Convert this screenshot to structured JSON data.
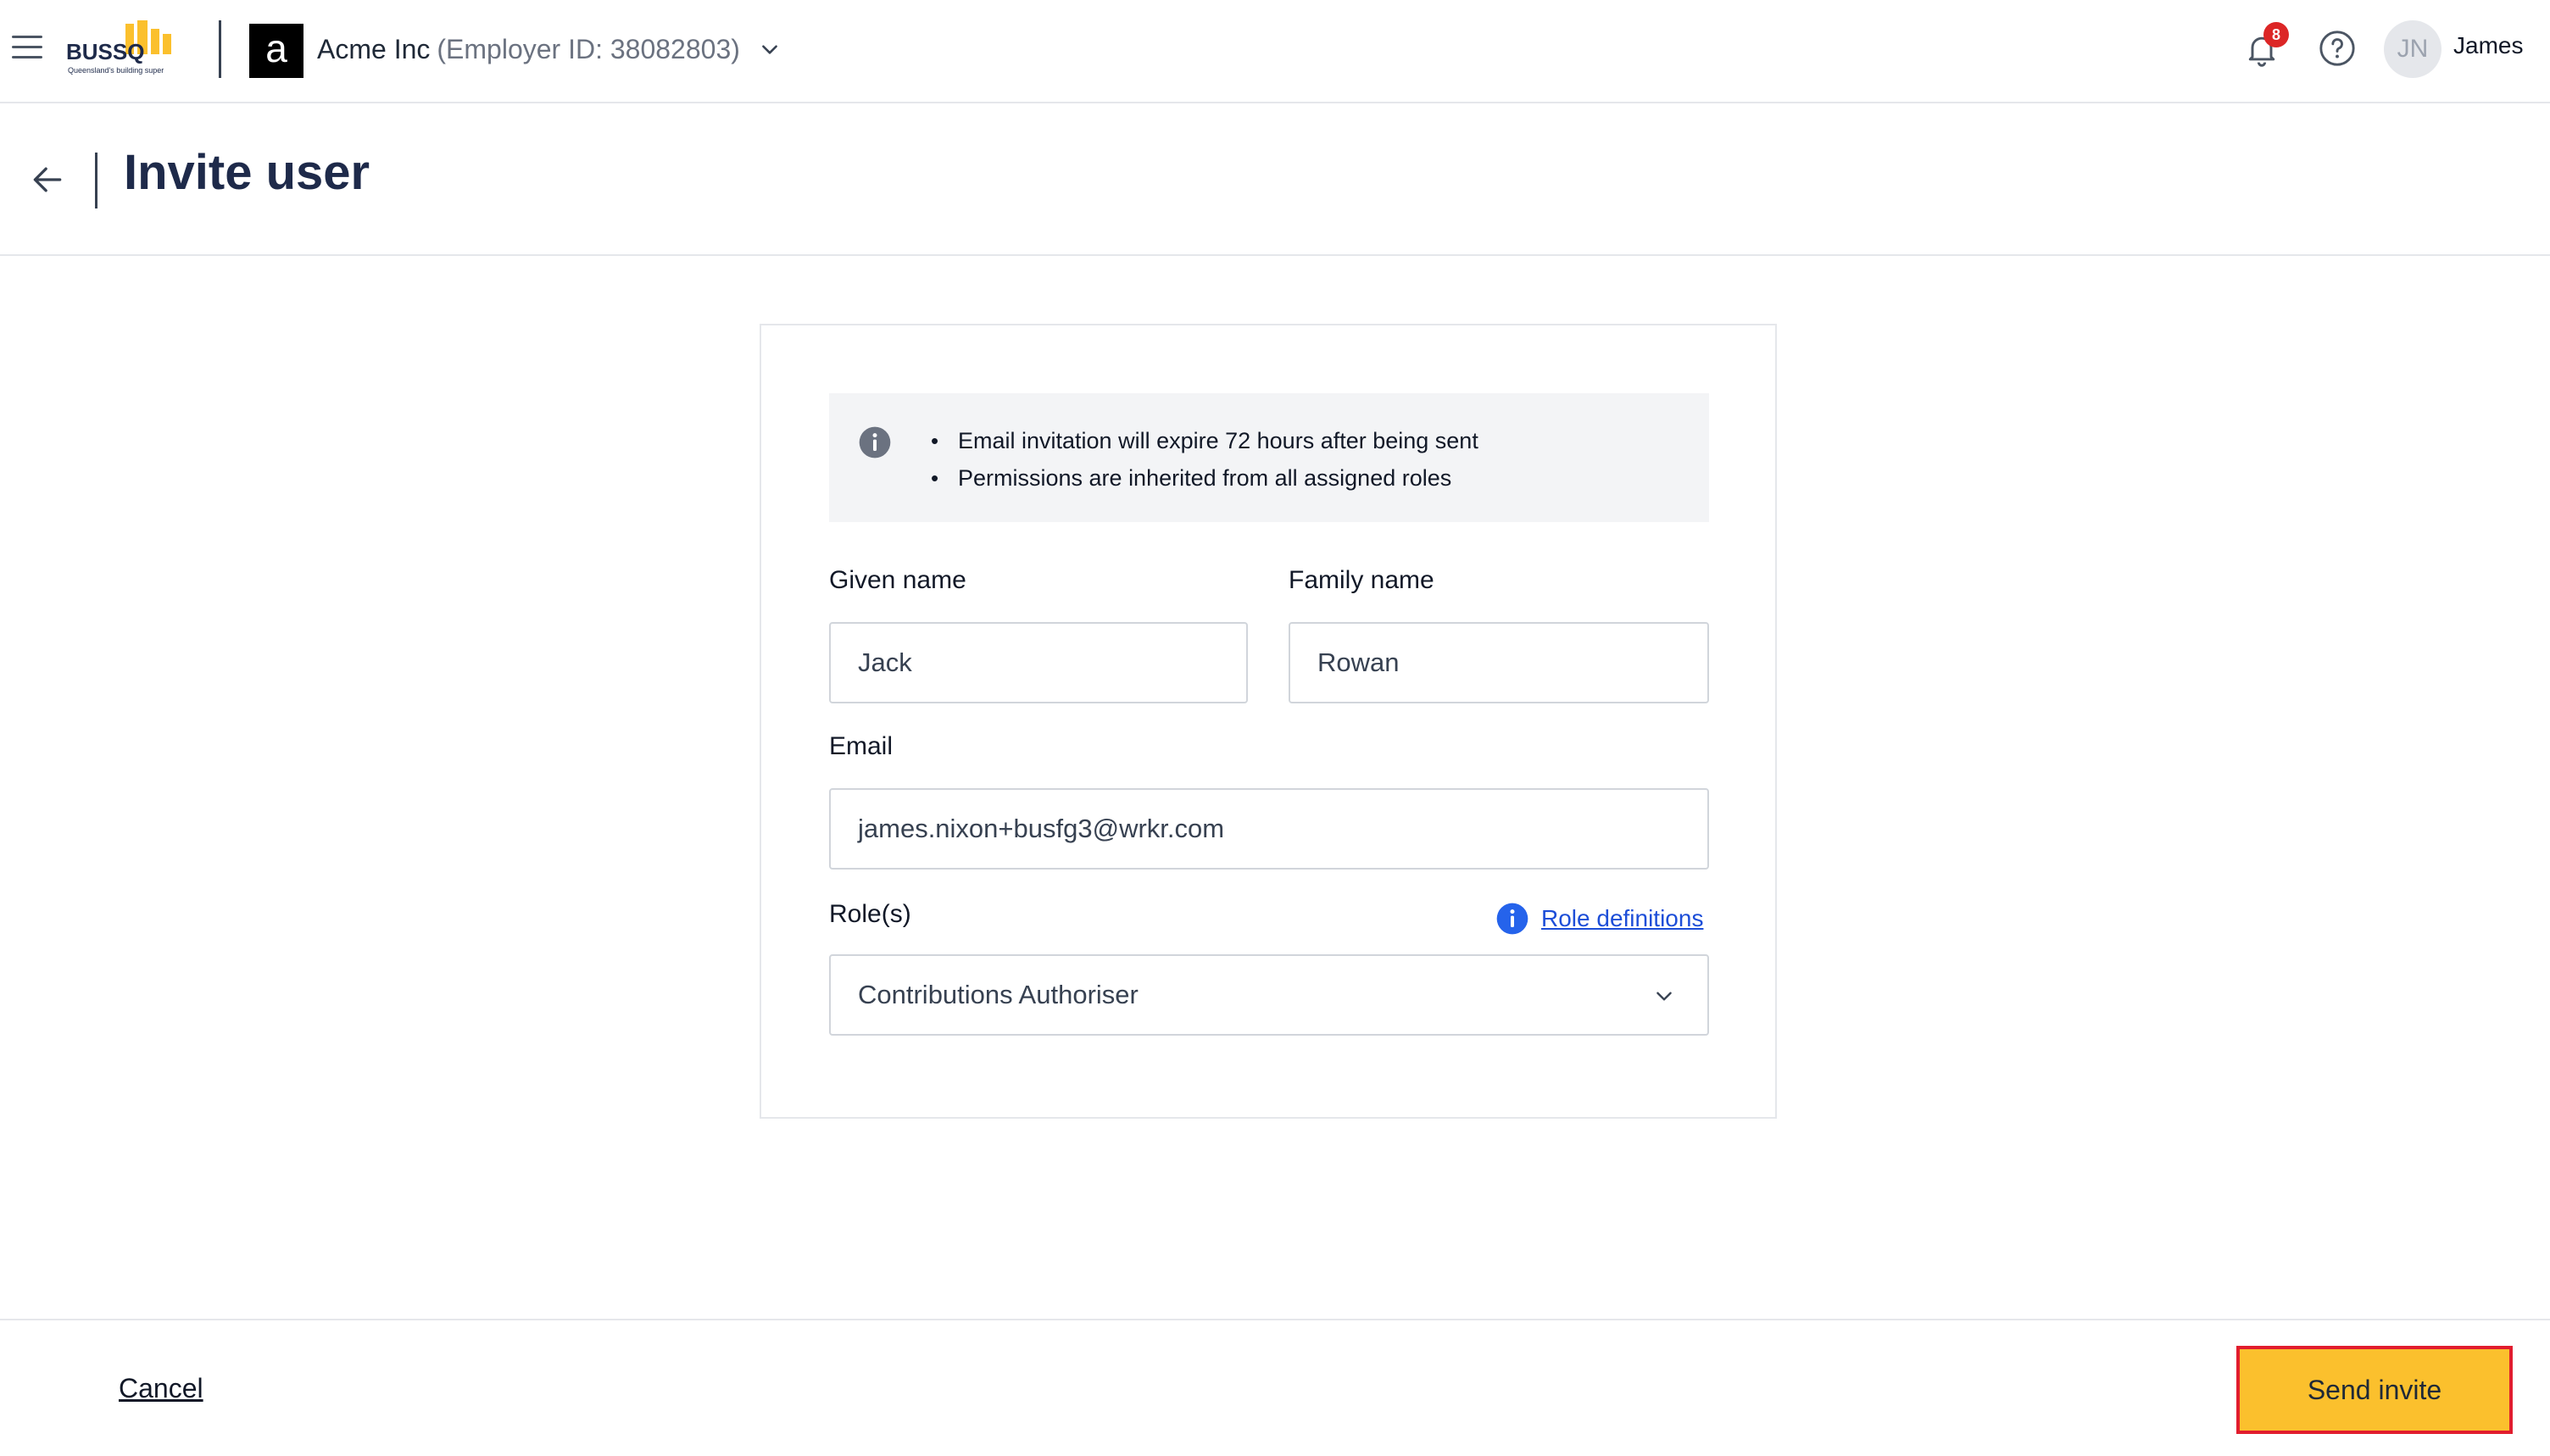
{
  "header": {
    "menu_icon": "hamburger-icon",
    "logo": {
      "wordmark": "BUSSQ",
      "tagline": "Queensland's building super"
    },
    "org": {
      "initial": "a",
      "name": "Acme Inc",
      "employer_id": "(Employer ID: 38082803)"
    },
    "notifications": {
      "icon": "bell-icon",
      "count": "8"
    },
    "help_icon": "help-circle-icon",
    "user": {
      "initials": "JN",
      "name": "James"
    }
  },
  "page": {
    "title": "Invite user",
    "back_icon": "arrow-left-icon"
  },
  "info": {
    "items": [
      "Email invitation will expire 72 hours after being sent",
      "Permissions are inherited from all assigned roles"
    ]
  },
  "form": {
    "given_name": {
      "label": "Given name",
      "value": "Jack"
    },
    "family_name": {
      "label": "Family name",
      "value": "Rowan"
    },
    "email": {
      "label": "Email",
      "value": "james.nixon+busfg3@wrkr.com"
    },
    "roles": {
      "label": "Role(s)",
      "value": "Contributions Authoriser",
      "definitions_link": "Role definitions"
    }
  },
  "footer": {
    "cancel_label": "Cancel",
    "send_label": "Send invite"
  },
  "colors": {
    "brand_yellow": "#fbc02d",
    "brand_navy": "#1e2a4a",
    "link_blue": "#1d4ed8",
    "badge_red": "#dc2626",
    "highlight_border": "#e11d2e"
  }
}
